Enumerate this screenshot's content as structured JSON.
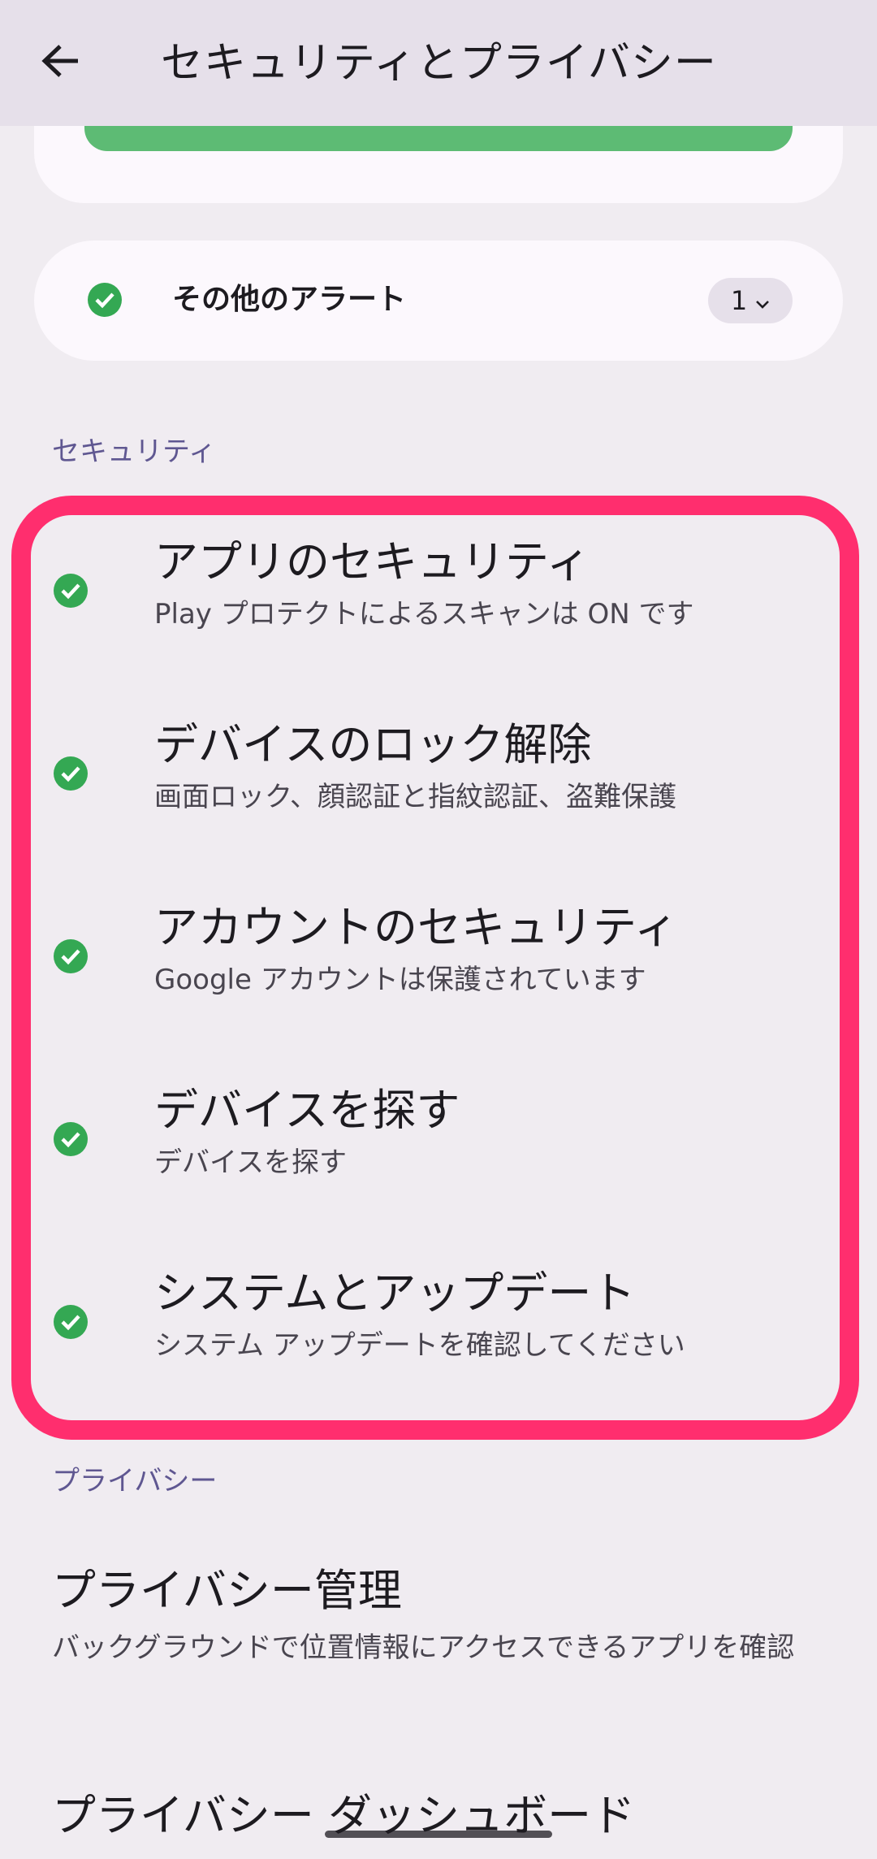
{
  "app_bar": {
    "title": "セキュリティとプライバシー",
    "back_icon": "arrow-back-icon"
  },
  "alerts": {
    "label": "その他のアラート",
    "count": "1",
    "status_icon": "check-circle-icon"
  },
  "security": {
    "header": "セキュリティ",
    "items": [
      {
        "title": "アプリのセキュリティ",
        "subtitle": "Play プロテクトによるスキャンは ON です"
      },
      {
        "title": "デバイスのロック解除",
        "subtitle": "画面ロック、顔認証と指紋認証、盗難保護"
      },
      {
        "title": "アカウントのセキュリティ",
        "subtitle": "Google アカウントは保護されています"
      },
      {
        "title": "デバイスを探す",
        "subtitle": "デバイスを探す"
      },
      {
        "title": "システムとアップデート",
        "subtitle": "システム アップデートを確認してください"
      }
    ]
  },
  "privacy": {
    "header": "プライバシー",
    "items": [
      {
        "title": "プライバシー管理",
        "subtitle": "バックグラウンドで位置情報にアクセスできるアプリを確認"
      },
      {
        "title": "プライバシー ダッシュボード"
      }
    ]
  },
  "colors": {
    "background": "#F0ECF1",
    "app_bar": "#E6E0EA",
    "card": "#FCF8FD",
    "accent_green": "#34A853",
    "progress_green": "#5DBB74",
    "highlight": "#FF2E6E",
    "section_header": "#5F5791"
  }
}
